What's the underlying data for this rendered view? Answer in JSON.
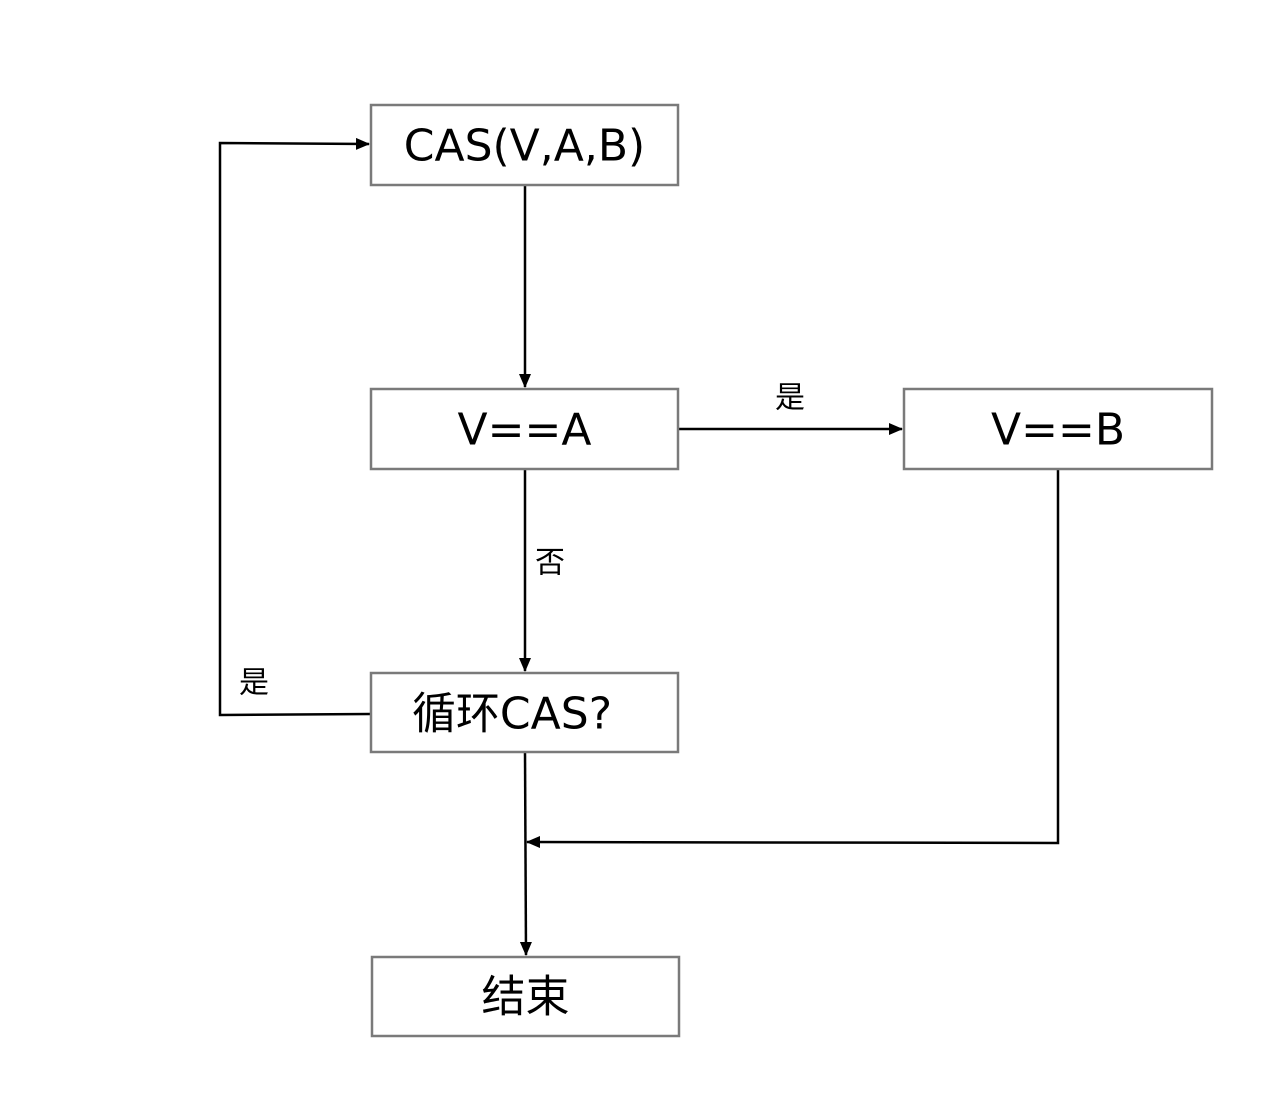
{
  "nodes": {
    "cas": "CAS(V,A,B)",
    "v_eq_a": "V==A",
    "v_eq_b": "V==B",
    "loop": "循环CAS?",
    "end": "结束"
  },
  "edge_labels": {
    "yes_to_b": "是",
    "no_to_loop": "否",
    "yes_loop_back": "是"
  }
}
